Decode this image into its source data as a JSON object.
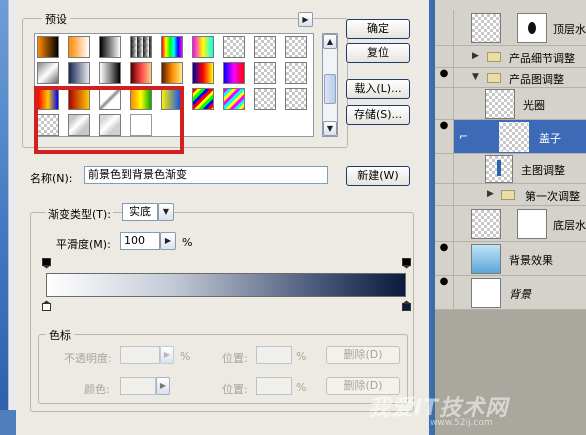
{
  "dialog": {
    "presets_label": "预设",
    "ok_label": "确定",
    "reset_label": "复位",
    "load_label": "载入(L)...",
    "save_label": "存储(S)...",
    "name_label": "名称(N):",
    "name_value": "前景色到背景色渐变",
    "new_label": "新建(W)",
    "gradient_type_label": "渐变类型(T):",
    "gradient_type_value": "实底",
    "smoothness_label": "平滑度(M):",
    "smoothness_value": "100",
    "smoothness_unit": "%",
    "color_stops_label": "色标",
    "opacity_label": "不透明度:",
    "opacity_unit": "%",
    "location_label": "位置:",
    "location_unit": "%",
    "delete_label": "删除(D)",
    "color_label": "颜色:",
    "location2_label": "位置:",
    "location2_unit": "%",
    "delete2_label": "删除(D)",
    "colors": {
      "highlight": "#d0201f",
      "gradient_start": "#ffffff",
      "gradient_end": "#0b1a3d"
    }
  },
  "layers": {
    "items": [
      {
        "name": "顶层水",
        "visible": false
      },
      {
        "name": "产品细节调整",
        "visible": false
      },
      {
        "name": "产品图调整",
        "visible": true
      },
      {
        "name": "光圈",
        "visible": false
      },
      {
        "name": "盖子",
        "visible": true,
        "selected": true
      },
      {
        "name": "主图调整",
        "visible": false
      },
      {
        "name": "第一次调整",
        "visible": false
      },
      {
        "name": "底层水",
        "visible": false
      },
      {
        "name": "背景效果",
        "visible": true
      },
      {
        "name": "背景",
        "visible": true
      }
    ]
  },
  "watermark": {
    "text": "我爱IT技术网",
    "sub": "www.52ij.com"
  }
}
